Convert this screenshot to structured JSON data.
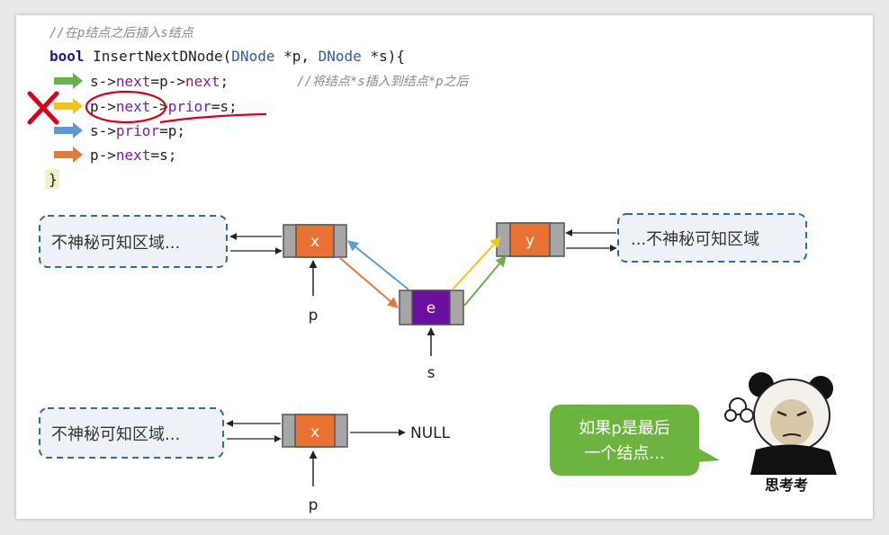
{
  "code": {
    "comment_title": "//在p结点之后插入s结点",
    "signature": {
      "keyword": "bool",
      "fn_name": " InsertNextDNode(",
      "type1": "DNode",
      "param1": " *p, ",
      "type2": "DNode",
      "param2": " *s){"
    },
    "line1": {
      "pre": "s->",
      "f1": "next",
      "mid": "=p->",
      "f2": "next",
      "post": ";"
    },
    "line1_comment": "//将结点*s插入到结点*p之后",
    "line2": {
      "pre": "p->",
      "f1": "next",
      "mid": "->",
      "f2": "prior",
      "post": "=s;"
    },
    "line3": {
      "pre": "s->",
      "f1": "prior",
      "post": "=p;"
    },
    "line4": {
      "pre": "p->",
      "f1": "next",
      "post": "=s;"
    },
    "close_brace": "}"
  },
  "diagram": {
    "region_left": "不神秘可知区域...",
    "region_right": "...不神秘可知区域",
    "node_x": "x",
    "node_y": "y",
    "node_e": "e",
    "label_p": "p",
    "label_s": "s"
  },
  "bottom": {
    "region_left": "不神秘可知区域...",
    "node_x": "x",
    "null_label": "NULL",
    "label_p": "p"
  },
  "bubble": {
    "line1": "如果p是最后",
    "line2": "一个结点..."
  },
  "meme": {
    "caption": "思考考"
  },
  "colors": {
    "green": "#6ab04c",
    "yellow": "#f2c318",
    "blue": "#5b9bd5",
    "orange": "#e07b39",
    "node_orange": "#e97132",
    "node_purple": "#6a0f9e",
    "node_gray": "#a6a6a6",
    "dashed_border": "#2e6da4",
    "region_fill": "#eef2f7",
    "red_mark": "#d9001b",
    "bubble_green": "#6cb33f"
  },
  "icons": [
    "arrow-green-icon",
    "arrow-yellow-icon",
    "arrow-blue-icon",
    "arrow-orange-icon",
    "red-cross-icon",
    "panda-meme-icon"
  ]
}
